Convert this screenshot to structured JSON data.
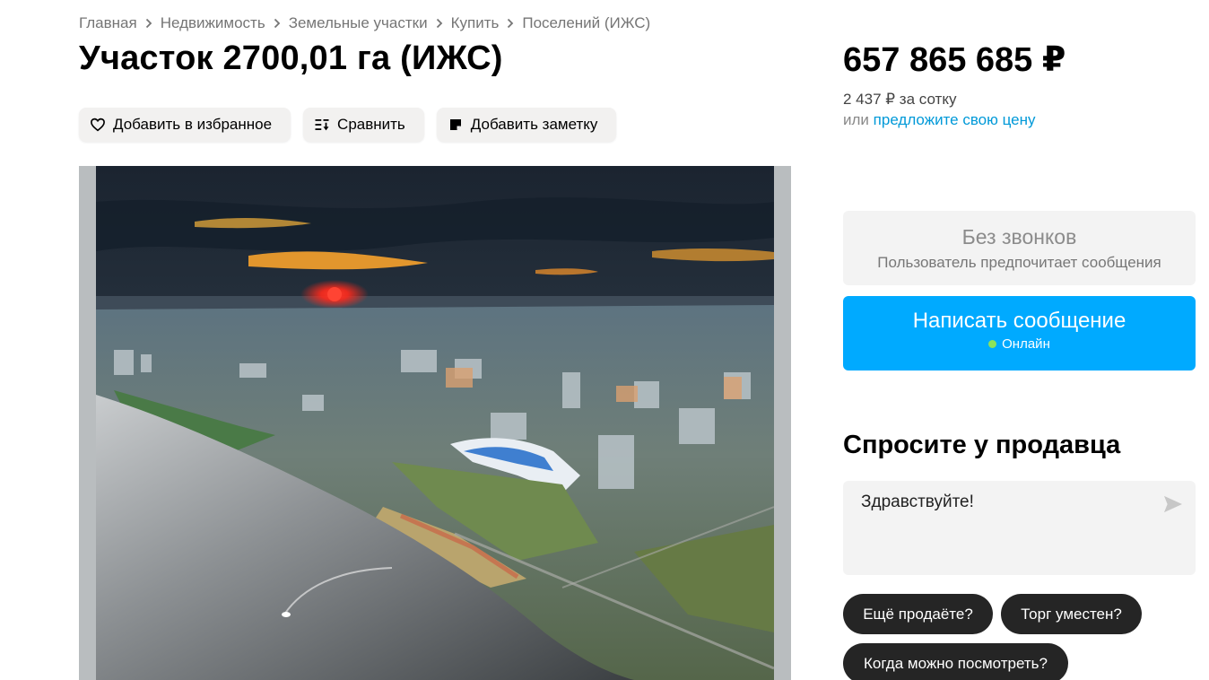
{
  "breadcrumbs": [
    "Главная",
    "Недвижимость",
    "Земельные участки",
    "Купить",
    "Поселений (ИЖС)"
  ],
  "title": "Участок 2700,01 га (ИЖС)",
  "actions": {
    "favorite": "Добавить в избранное",
    "compare": "Сравнить",
    "note": "Добавить заметку"
  },
  "price": {
    "total": "657 865 685 ₽",
    "per_sotka": "2 437 ₽ за сотку",
    "offer_prefix": "или",
    "offer_link": "предложите свою цену"
  },
  "contact": {
    "no_calls_title": "Без звонков",
    "no_calls_sub": "Пользователь предпочитает сообщения",
    "write_label": "Написать сообщение",
    "online": "Онлайн"
  },
  "ask": {
    "title": "Спросите у продавца",
    "message": "Здравствуйте!",
    "chips": [
      "Ещё продаёте?",
      "Торг уместен?",
      "Когда можно посмотреть?"
    ]
  },
  "colors": {
    "accent": "#00aaff",
    "link": "#0099d8",
    "online_dot": "#8ee35a",
    "chip_bg": "#252525"
  }
}
